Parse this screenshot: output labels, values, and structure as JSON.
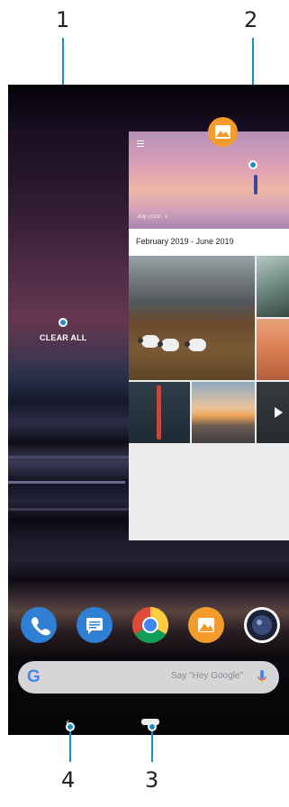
{
  "callouts": [
    {
      "number": "1"
    },
    {
      "number": "2"
    },
    {
      "number": "3"
    },
    {
      "number": "4"
    }
  ],
  "recents": {
    "clear_all_label": "CLEAR ALL"
  },
  "app_card": {
    "app_icon": "photos-landscape-icon",
    "hero_caption": "July 2019 · 2",
    "subheader": "February 2019 - June 2019"
  },
  "dock": {
    "apps": [
      {
        "icon": "phone-icon",
        "color": "#2f7fd4"
      },
      {
        "icon": "messages-icon",
        "color": "#2f7fd4"
      },
      {
        "icon": "chrome-icon",
        "color": "#dd4b39"
      },
      {
        "icon": "album-icon",
        "color": "#f39c2c"
      },
      {
        "icon": "camera-icon",
        "color": "#ffffff"
      }
    ]
  },
  "search": {
    "hint": "Say \"Hey Google\"",
    "logo": "G"
  },
  "navigation": {
    "back_glyph": "‹",
    "home_icon": "home-pill-icon"
  },
  "colors": {
    "callout": "#1a8fc9",
    "search_bar": "#d6d6d9"
  }
}
